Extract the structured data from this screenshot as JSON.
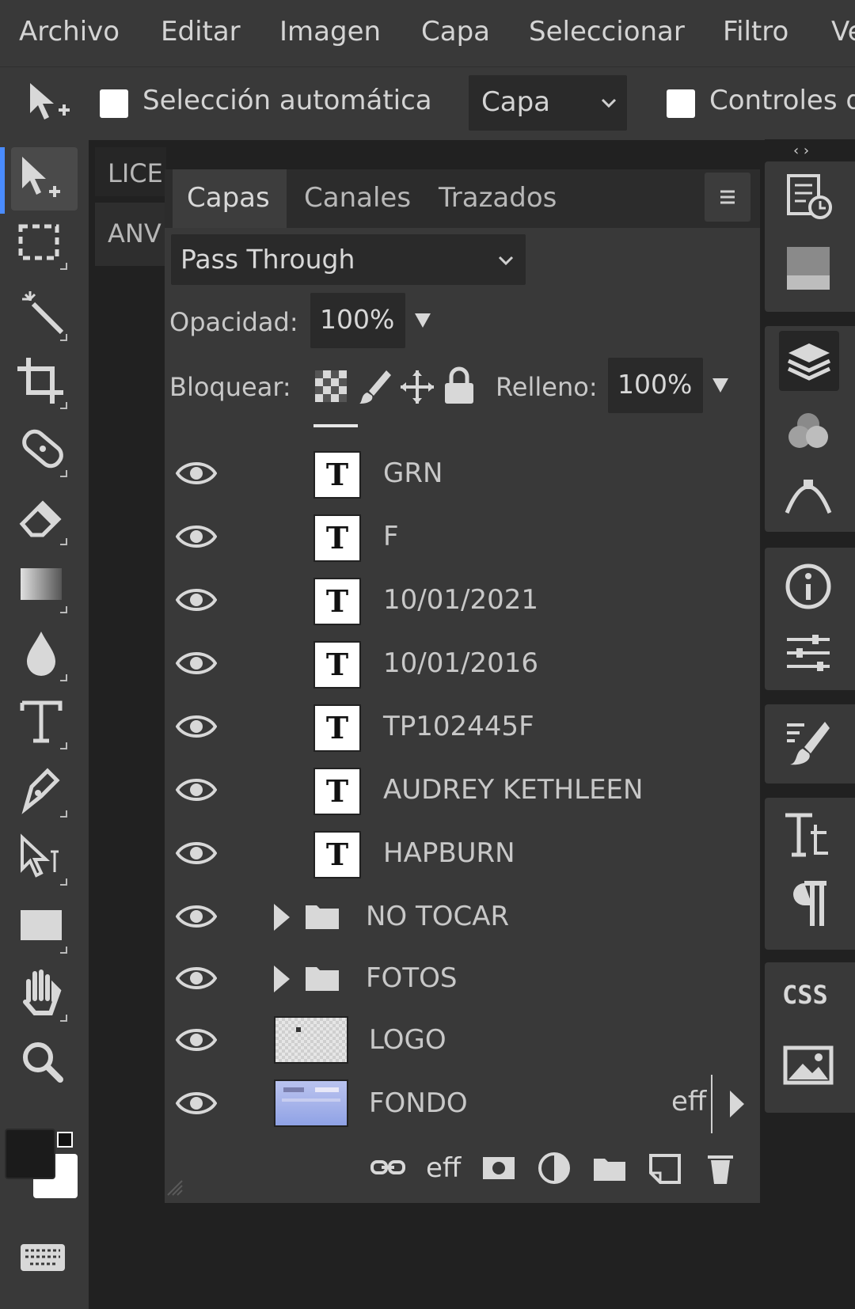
{
  "menubar": {
    "items": [
      "Archivo",
      "Editar",
      "Imagen",
      "Capa",
      "Seleccionar",
      "Filtro",
      "Ve"
    ]
  },
  "options": {
    "auto_select_label": "Selección automática",
    "target_select_value": "Capa",
    "controls_label": "Controles d"
  },
  "doc_tabs": [
    "LICE",
    "ANV"
  ],
  "dock_toggle": "‹ ›",
  "layers_panel": {
    "tabs": [
      "Capas",
      "Canales",
      "Trazados"
    ],
    "blend_mode": "Pass Through",
    "opacity_label": "Opacidad:",
    "opacity_value": "100%",
    "lock_label": "Bloquear:",
    "fill_label": "Relleno:",
    "fill_value": "100%",
    "layers": [
      {
        "name": "GRN",
        "type": "text"
      },
      {
        "name": "F",
        "type": "text"
      },
      {
        "name": "10/01/2021",
        "type": "text"
      },
      {
        "name": "10/01/2016",
        "type": "text"
      },
      {
        "name": "TP102445F",
        "type": "text"
      },
      {
        "name": "AUDREY KETHLEEN",
        "type": "text"
      },
      {
        "name": "HAPBURN",
        "type": "text"
      },
      {
        "name": "NO TOCAR",
        "type": "folder"
      },
      {
        "name": "FOTOS",
        "type": "folder"
      },
      {
        "name": "LOGO",
        "type": "image"
      },
      {
        "name": "FONDO",
        "type": "image",
        "effects_label": "eff"
      }
    ],
    "bottom_effects_label": "eff",
    "text_thumb_glyph": "T"
  },
  "right_dock": {
    "css_label": "CSS"
  },
  "colors": {
    "accent": "#4a8cff",
    "panel_bg": "#393939",
    "app_bg": "#212121"
  }
}
